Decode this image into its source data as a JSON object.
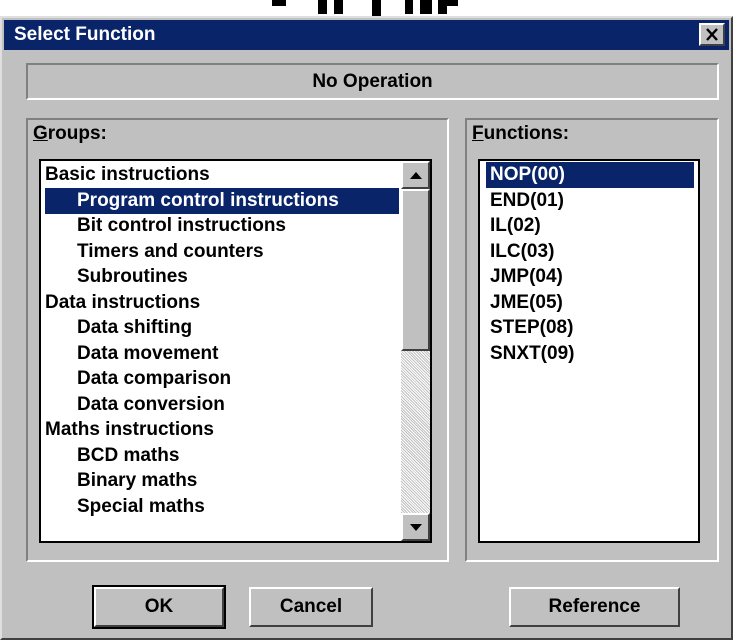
{
  "window": {
    "title": "Select Function",
    "close_icon": "close-icon"
  },
  "status": {
    "operation": "No Operation"
  },
  "groups": {
    "label_access": "G",
    "label_rest": "roups:",
    "items": [
      {
        "label": "Basic instructions",
        "level": 0,
        "selected": false
      },
      {
        "label": "Program control instructions",
        "level": 1,
        "selected": true
      },
      {
        "label": "Bit control instructions",
        "level": 1,
        "selected": false
      },
      {
        "label": "Timers and counters",
        "level": 1,
        "selected": false
      },
      {
        "label": "Subroutines",
        "level": 1,
        "selected": false
      },
      {
        "label": "Data instructions",
        "level": 0,
        "selected": false
      },
      {
        "label": "Data shifting",
        "level": 1,
        "selected": false
      },
      {
        "label": "Data movement",
        "level": 1,
        "selected": false
      },
      {
        "label": "Data comparison",
        "level": 1,
        "selected": false
      },
      {
        "label": "Data conversion",
        "level": 1,
        "selected": false
      },
      {
        "label": "Maths instructions",
        "level": 0,
        "selected": false
      },
      {
        "label": "BCD maths",
        "level": 1,
        "selected": false
      },
      {
        "label": "Binary maths",
        "level": 1,
        "selected": false
      },
      {
        "label": "Special maths",
        "level": 1,
        "selected": false
      }
    ],
    "scroll_up_icon": "scroll-up-arrow-icon",
    "scroll_down_icon": "scroll-down-arrow-icon"
  },
  "functions": {
    "label_access": "F",
    "label_rest": "unctions:",
    "items": [
      {
        "label": "NOP(00)",
        "selected": true
      },
      {
        "label": "END(01)",
        "selected": false
      },
      {
        "label": "IL(02)",
        "selected": false
      },
      {
        "label": "ILC(03)",
        "selected": false
      },
      {
        "label": "JMP(04)",
        "selected": false
      },
      {
        "label": "JME(05)",
        "selected": false
      },
      {
        "label": "STEP(08)",
        "selected": false
      },
      {
        "label": "SNXT(09)",
        "selected": false
      }
    ]
  },
  "buttons": {
    "ok": "OK",
    "cancel": "Cancel",
    "reference": "Reference"
  },
  "colors": {
    "titlebar": "#0a246a",
    "face": "#c0c0c0",
    "selection": "#0a246a"
  }
}
